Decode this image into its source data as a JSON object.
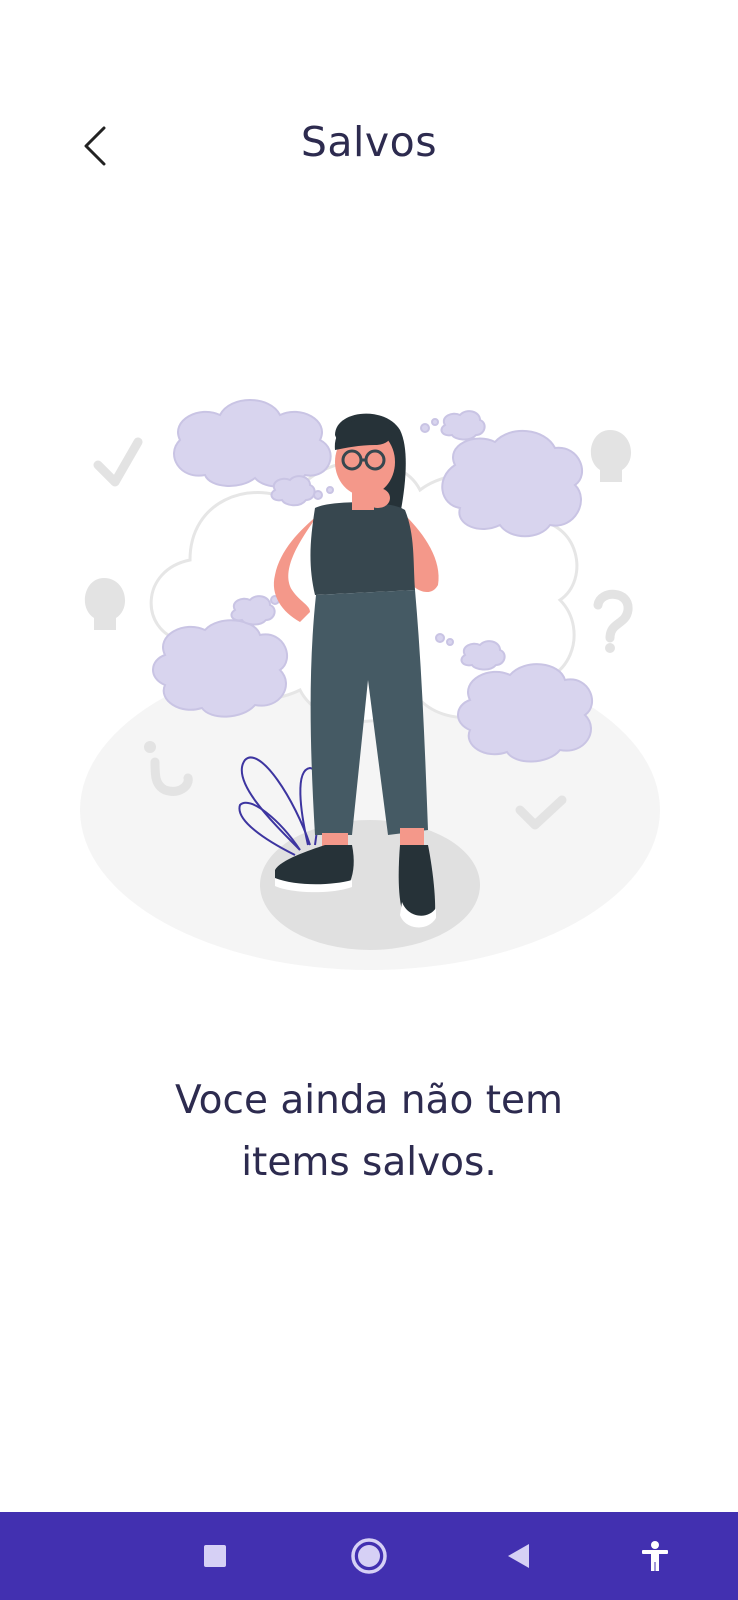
{
  "header": {
    "title": "Salvos",
    "back_icon": "chevron-left-icon"
  },
  "empty_state": {
    "illustration": "thinking-woman-with-thought-bubbles",
    "message_line1": "Voce ainda não tem",
    "message_line2": "items salvos."
  },
  "system_nav": {
    "items": [
      {
        "name": "recents-square-icon"
      },
      {
        "name": "home-circle-icon"
      },
      {
        "name": "back-triangle-icon"
      },
      {
        "name": "accessibility-icon"
      }
    ],
    "background": "#4230b0"
  },
  "colors": {
    "title": "#2d2b4f",
    "bubble": "#d8d4ee",
    "shirt": "#37474f",
    "pants": "#455a64",
    "skin": "#f4988a"
  }
}
